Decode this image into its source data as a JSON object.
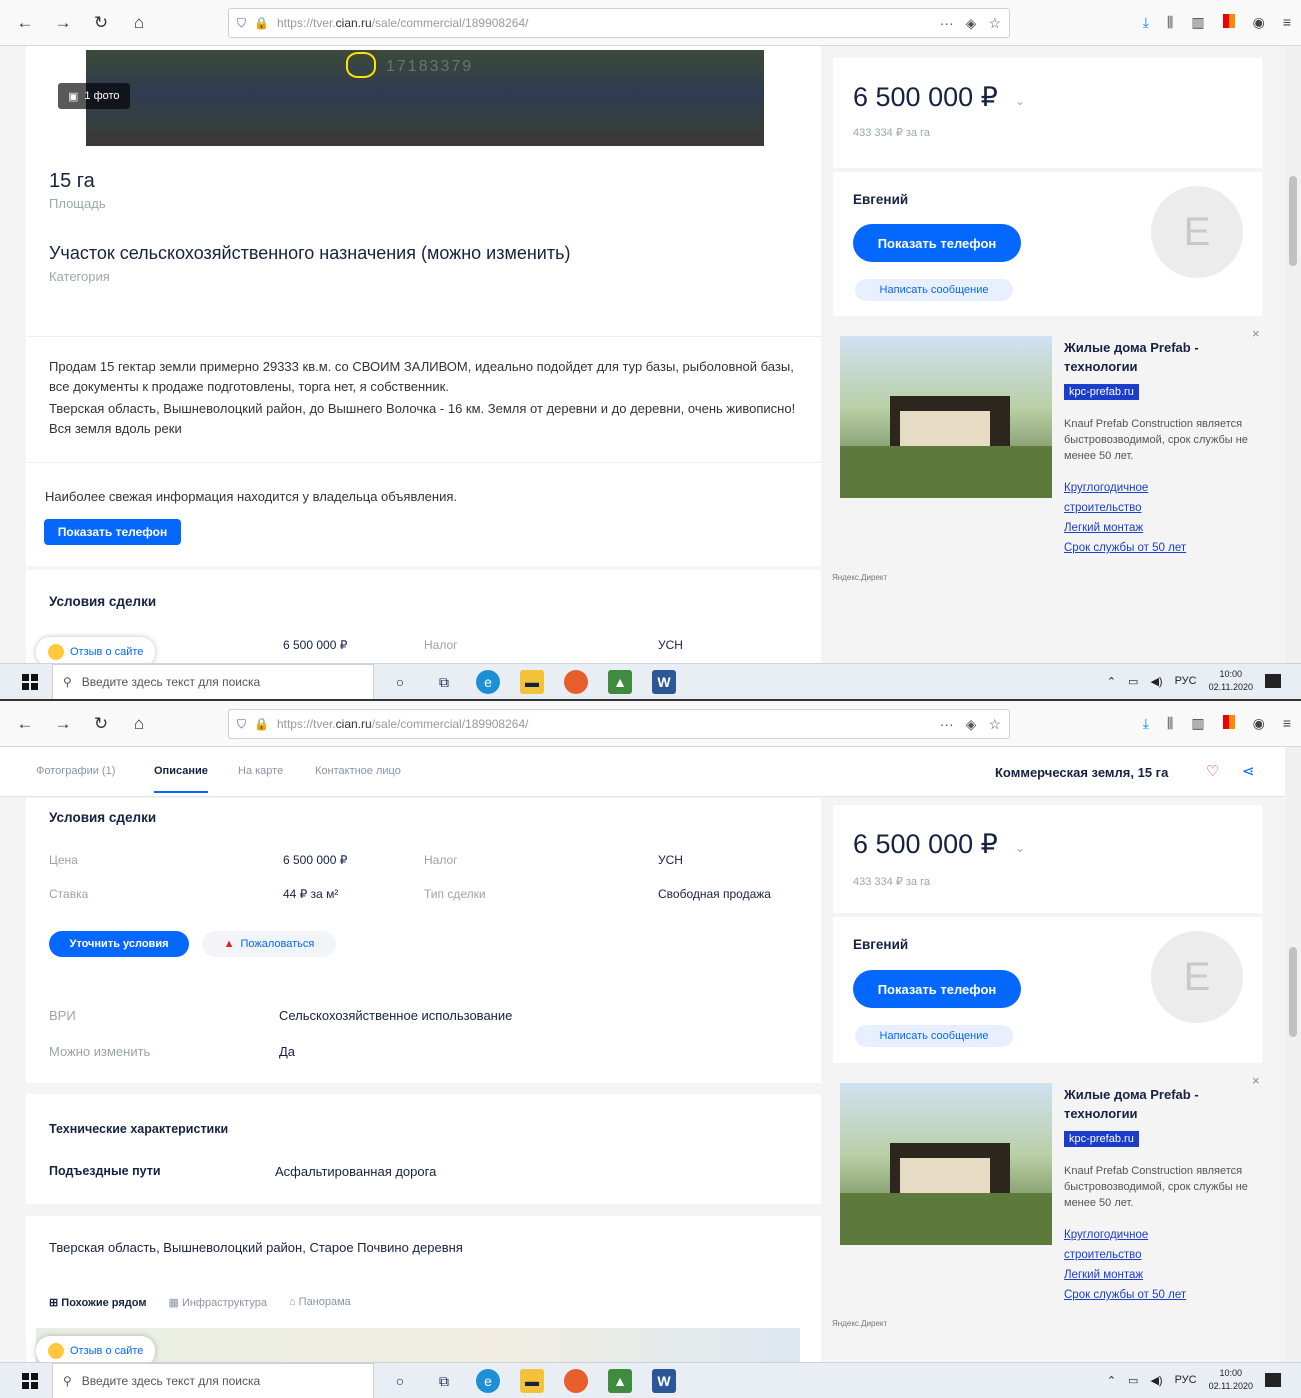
{
  "browser": {
    "url_prefix": "https://tver.",
    "url_domain": "cian.ru",
    "url_path": "/sale/commercial/189908264/",
    "menu": "···"
  },
  "screen1": {
    "photo_count": "1 фото",
    "map_id": "17183379",
    "area_value": "15 га",
    "area_label": "Площадь",
    "category_value": "Участок сельскохозяйственного назначения (можно изменить)",
    "category_label": "Категория",
    "description": [
      "Продам 15 гектар земли примерно 29333 кв.м. со СВОИМ ЗАЛИВОМ, идеально подойдет для тур базы, рыболовной базы, все документы к продаже подготовлены, торга нет, я собственник.",
      "Тверская область, Вышневолоцкий район, до Вышнего Волочка - 16 км. Земля от деревни и до деревни, очень живописно! Вся земля вдоль реки"
    ],
    "fresh_info": "Наиболее свежая информация находится у владельца объявления.",
    "show_phone": "Показать телефон",
    "deal_title": "Условия сделки",
    "deal_price": "6 500 000 ₽",
    "deal_tax_label": "Налог",
    "deal_tax_value": "УСН"
  },
  "screen2": {
    "tabs": [
      "Фотографии (1)",
      "Описание",
      "На карте",
      "Контактное лицо"
    ],
    "header_title": "Коммерческая земля, 15 га",
    "deal_title": "Условия сделки",
    "rows": [
      {
        "l1": "Цена",
        "v1": "6 500 000 ₽",
        "l2": "Налог",
        "v2": "УСН"
      },
      {
        "l1": "Ставка",
        "v1": "44 ₽ за м²",
        "l2": "Тип сделки",
        "v2": "Свободная продажа"
      }
    ],
    "clarify_btn": "Уточнить условия",
    "complain_btn": "Пожаловаться",
    "vri_label": "ВРИ",
    "vri_value": "Сельскохозяйственное использование",
    "change_label": "Можно изменить",
    "change_value": "Да",
    "tech_title": "Технические характеристики",
    "access_label": "Подъездные пути",
    "access_value": "Асфальтированная дорога",
    "address": "Тверская область, Вышневолоцкий район, Старое Почвино деревня",
    "map_tabs": [
      "Похожие рядом",
      "Инфраструктура",
      "Панорама"
    ]
  },
  "sidebar": {
    "price": "6 500 000 ₽",
    "price_per": "433 334 ₽ за га",
    "seller": "Евгений",
    "avatar_letter": "Е",
    "show_phone": "Показать телефон",
    "write": "Написать сообщение"
  },
  "ad": {
    "title": "Жилые дома Prefab - технологии",
    "domain": "kpc-prefab.ru",
    "desc": "Knauf Prefab Construction является быстровозводимой, срок службы не менее 50 лет.",
    "links": [
      "Круглогодичное строительство",
      "Легкий монтаж",
      "Срок службы от 50 лет"
    ],
    "source": "Яндекс.Директ",
    "close": "×"
  },
  "feedback": "Отзыв о сайте",
  "taskbar": {
    "search": "Введите здесь текст для поиска",
    "lang": "РУС",
    "time": "10:00",
    "date": "02.11.2020"
  },
  "colors": {
    "accent": "#0468ff",
    "text": "#152242",
    "ad_domain": "#1a3ec9"
  }
}
